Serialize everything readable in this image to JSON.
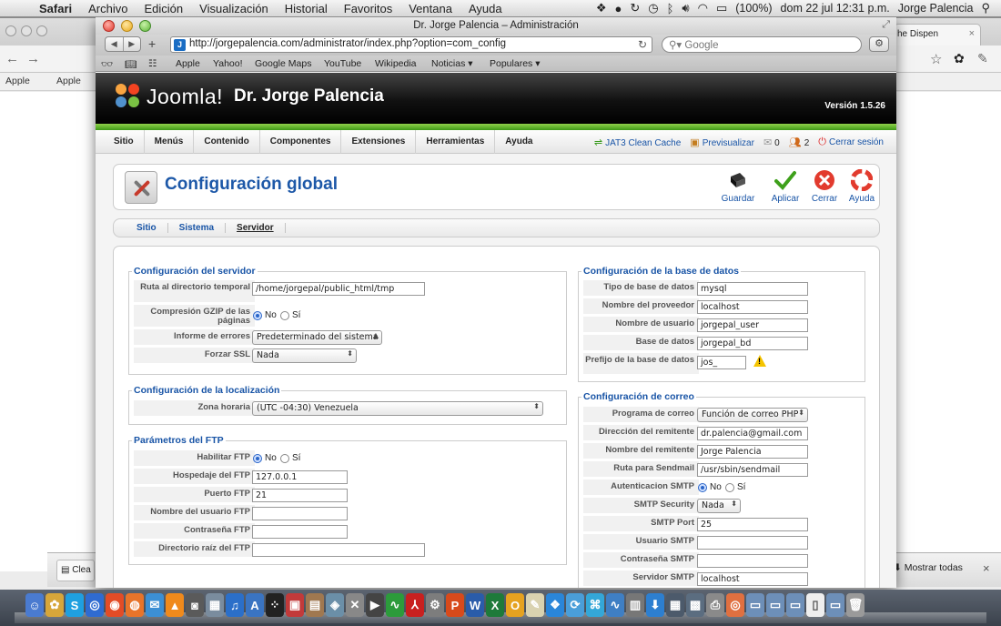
{
  "menubar": {
    "app": "Safari",
    "items": [
      "Archivo",
      "Edición",
      "Visualización",
      "Historial",
      "Favoritos",
      "Ventana",
      "Ayuda"
    ],
    "battery": "(100%)",
    "datetime": "dom 22 jul  12:31 p.m.",
    "user": "Jorge Palencia"
  },
  "background_browser": {
    "tab_title": "he Dispen",
    "bookmarks": [
      "Apple",
      "Apple"
    ],
    "downloads": {
      "item_label": "Clea",
      "show_all": "Mostrar todas"
    }
  },
  "safari": {
    "window_title": "Dr. Jorge Palencia – Administración",
    "url": "http://jorgepalencia.com/administrator/index.php?option=com_config",
    "search_placeholder": "Google",
    "bookmarks": [
      "Apple",
      "Yahoo!",
      "Google Maps",
      "YouTube",
      "Wikipedia",
      "Noticias ▾",
      "Populares ▾"
    ]
  },
  "joomla": {
    "brand": "Joomla!",
    "site_name": "Dr. Jorge Palencia",
    "version": "Versión 1.5.26",
    "menu": [
      "Sitio",
      "Menús",
      "Contenido",
      "Componentes",
      "Extensiones",
      "Herramientas",
      "Ayuda"
    ],
    "status": {
      "cache": "JAT3 Clean Cache",
      "preview": "Previsualizar",
      "messages": "0",
      "users": "2",
      "logout": "Cerrar sesión"
    },
    "page_title": "Configuración global",
    "toolbar": {
      "save": "Guardar",
      "apply": "Aplicar",
      "close": "Cerrar",
      "help": "Ayuda"
    },
    "tabs": [
      "Sitio",
      "Sistema",
      "Servidor"
    ],
    "active_tab": "Servidor",
    "server": {
      "legend": "Configuración del servidor",
      "tmp_label": "Ruta al directorio temporal",
      "tmp_value": "/home/jorgepal/public_html/tmp",
      "gzip_label": "Compresión GZIP de las páginas",
      "gzip_no": "No",
      "gzip_yes": "Sí",
      "gzip_selected": "No",
      "error_label": "Informe de errores",
      "error_value": "Predeterminado del sistema",
      "ssl_label": "Forzar SSL",
      "ssl_value": "Nada"
    },
    "locale": {
      "legend": "Configuración de la localización",
      "tz_label": "Zona horaria",
      "tz_value": "(UTC -04:30) Venezuela"
    },
    "ftp": {
      "legend": "Parámetros del FTP",
      "enable_label": "Habilitar FTP",
      "enable_no": "No",
      "enable_yes": "Sí",
      "enable_selected": "No",
      "host_label": "Hospedaje del FTP",
      "host_value": "127.0.0.1",
      "port_label": "Puerto FTP",
      "port_value": "21",
      "user_label": "Nombre del usuario FTP",
      "user_value": "",
      "pass_label": "Contraseña FTP",
      "pass_value": "",
      "root_label": "Directorio raíz del FTP",
      "root_value": ""
    },
    "database": {
      "legend": "Configuración de la base de datos",
      "type_label": "Tipo de base de datos",
      "type_value": "mysql",
      "host_label": "Nombre del proveedor",
      "host_value": "localhost",
      "user_label": "Nombre de usuario",
      "user_value": "jorgepal_user",
      "db_label": "Base de datos",
      "db_value": "jorgepal_bd",
      "prefix_label": "Prefijo de la base de datos",
      "prefix_value": "jos_"
    },
    "mail": {
      "legend": "Configuración de correo",
      "mailer_label": "Programa de correo",
      "mailer_value": "Función de correo PHP",
      "from_label": "Dirección del remitente",
      "from_value": "dr.palencia@gmail.com",
      "fromname_label": "Nombre del remitente",
      "fromname_value": "Jorge Palencia",
      "sendmail_label": "Ruta para Sendmail",
      "sendmail_value": "/usr/sbin/sendmail",
      "smtpauth_label": "Autenticacion SMTP",
      "smtpauth_no": "No",
      "smtpauth_yes": "Sí",
      "smtpauth_selected": "No",
      "security_label": "SMTP Security",
      "security_value": "Nada",
      "port_label": "SMTP Port",
      "port_value": "25",
      "smtpuser_label": "Usuario SMTP",
      "smtpuser_value": "",
      "smtppass_label": "Contraseña SMTP",
      "smtppass_value": "",
      "smtphost_label": "Servidor SMTP",
      "smtphost_value": "localhost"
    }
  },
  "colors": {
    "joomla_blue": "#1d58a8",
    "joomla_green": "#5db12a",
    "warning": "#f5c400"
  }
}
